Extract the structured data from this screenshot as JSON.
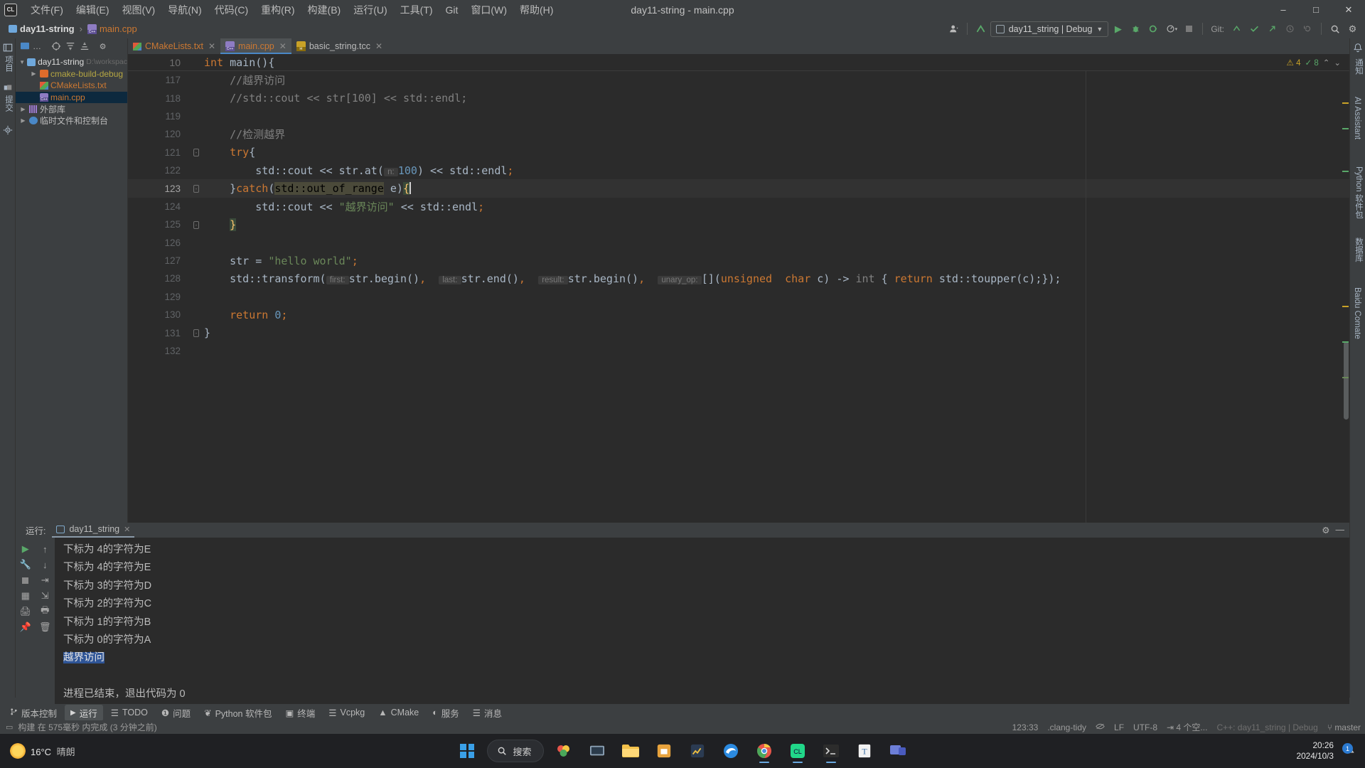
{
  "window": {
    "title": "day11-string - main.cpp"
  },
  "menu": {
    "items": [
      "文件(F)",
      "编辑(E)",
      "视图(V)",
      "导航(N)",
      "代码(C)",
      "重构(R)",
      "构建(B)",
      "运行(U)",
      "工具(T)",
      "Git",
      "窗口(W)",
      "帮助(H)"
    ],
    "logo": "CL"
  },
  "window_controls": {
    "minimize": "–",
    "maximize": "□",
    "close": "✕"
  },
  "navbar": {
    "project": "day11-string",
    "separator": "›",
    "file": "main.cpp",
    "run_config": "day11_string | Debug",
    "git_label": "Git:",
    "branch": "master"
  },
  "project_tool": {
    "title": "项目",
    "more": "…",
    "tree": [
      {
        "label": "day11-string",
        "path": "D:\\workspac",
        "expanded": true,
        "depth": 0,
        "icon": "module-icon"
      },
      {
        "label": "cmake-build-debug",
        "path": "",
        "expanded": false,
        "depth": 1,
        "icon": "folder-orange-icon"
      },
      {
        "label": "CMakeLists.txt",
        "path": "",
        "depth": 1,
        "icon": "cmake-icon"
      },
      {
        "label": "main.cpp",
        "path": "",
        "depth": 1,
        "icon": "cpp-icon",
        "selected": true
      },
      {
        "label": "外部库",
        "path": "",
        "expanded": false,
        "depth": 0,
        "icon": "library-icon"
      },
      {
        "label": "临时文件和控制台",
        "path": "",
        "expanded": false,
        "depth": 0,
        "icon": "scratch-icon"
      }
    ]
  },
  "left_strip": {
    "labels": [
      "项目",
      "提交",
      "结构"
    ]
  },
  "right_strip": {
    "labels": [
      "通知",
      "AI Assistant",
      "Python 软件包",
      "数据库",
      "Baidu Comate"
    ]
  },
  "tabs": [
    {
      "label": "CMakeLists.txt",
      "icon": "cmake-icon",
      "active": false
    },
    {
      "label": "main.cpp",
      "icon": "cpp-icon",
      "active": true
    },
    {
      "label": "basic_string.tcc",
      "icon": "header-icon",
      "active": false
    }
  ],
  "editor": {
    "sticky_line_number": "10",
    "sticky_text": "int main(){",
    "inspections": {
      "warnings": "4",
      "oks": "8"
    },
    "breadcrumb_function": "main",
    "lines": [
      {
        "n": "117",
        "tokens": [
          {
            "t": "    ",
            "c": "c-def"
          },
          {
            "t": "//越界访问",
            "c": "c-comment"
          }
        ]
      },
      {
        "n": "118",
        "tokens": [
          {
            "t": "    ",
            "c": "c-def"
          },
          {
            "t": "//std::cout << str[100] << std::endl;",
            "c": "c-comment"
          }
        ]
      },
      {
        "n": "119",
        "tokens": []
      },
      {
        "n": "120",
        "tokens": [
          {
            "t": "    ",
            "c": "c-def"
          },
          {
            "t": "//检测越界",
            "c": "c-comment"
          }
        ]
      },
      {
        "n": "121",
        "fold": "-",
        "tokens": [
          {
            "t": "    ",
            "c": "c-def"
          },
          {
            "t": "try",
            "c": "c-kw"
          },
          {
            "t": "{",
            "c": "c-punct"
          }
        ]
      },
      {
        "n": "122",
        "tokens": [
          {
            "t": "        ",
            "c": "c-def"
          },
          {
            "t": "std::cout",
            "c": "c-def"
          },
          {
            "t": " << ",
            "c": "c-punct"
          },
          {
            "t": "str.at(",
            "c": "c-def"
          },
          {
            "t": " n: ",
            "c": "c-hint"
          },
          {
            "t": "100",
            "c": "c-num"
          },
          {
            "t": ")",
            "c": "c-punct"
          },
          {
            "t": " << ",
            "c": "c-punct"
          },
          {
            "t": "std::endl",
            "c": "c-def"
          },
          {
            "t": ";",
            "c": "c-semi"
          }
        ]
      },
      {
        "n": "123",
        "current": true,
        "fold": "-",
        "tokens": [
          {
            "t": "    }",
            "c": "c-punct"
          },
          {
            "t": "catch",
            "c": "c-kw"
          },
          {
            "t": "(",
            "c": "c-punct"
          },
          {
            "t": "std::out_of_range",
            "c": "hl-ident"
          },
          {
            "t": " e)",
            "c": "c-punct"
          },
          {
            "t": "{",
            "c": "c-brace-hl"
          }
        ]
      },
      {
        "n": "124",
        "tokens": [
          {
            "t": "        ",
            "c": "c-def"
          },
          {
            "t": "std::cout",
            "c": "c-def"
          },
          {
            "t": " << ",
            "c": "c-punct"
          },
          {
            "t": "\"越界访问\"",
            "c": "c-str"
          },
          {
            "t": " << ",
            "c": "c-punct"
          },
          {
            "t": "std::endl",
            "c": "c-def"
          },
          {
            "t": ";",
            "c": "c-semi"
          }
        ]
      },
      {
        "n": "125",
        "fold": "-",
        "tokens": [
          {
            "t": "    ",
            "c": "c-def"
          },
          {
            "t": "}",
            "c": "c-brace-hl"
          }
        ]
      },
      {
        "n": "126",
        "tokens": []
      },
      {
        "n": "127",
        "tokens": [
          {
            "t": "    ",
            "c": "c-def"
          },
          {
            "t": "str",
            "c": "c-def"
          },
          {
            "t": " = ",
            "c": "c-punct"
          },
          {
            "t": "\"hello world\"",
            "c": "c-str"
          },
          {
            "t": ";",
            "c": "c-semi"
          }
        ]
      },
      {
        "n": "128",
        "tokens": [
          {
            "t": "    ",
            "c": "c-def"
          },
          {
            "t": "std::transform(",
            "c": "c-def"
          },
          {
            "t": " first: ",
            "c": "c-hint"
          },
          {
            "t": "str.begin()",
            "c": "c-def"
          },
          {
            "t": ",",
            "c": "c-semi"
          },
          {
            "t": "  ",
            "c": "c-def"
          },
          {
            "t": " last: ",
            "c": "c-hint"
          },
          {
            "t": "str.end()",
            "c": "c-def"
          },
          {
            "t": ",",
            "c": "c-semi"
          },
          {
            "t": "  ",
            "c": "c-def"
          },
          {
            "t": " result: ",
            "c": "c-hint"
          },
          {
            "t": "str.begin()",
            "c": "c-def"
          },
          {
            "t": ",",
            "c": "c-semi"
          },
          {
            "t": "  ",
            "c": "c-def"
          },
          {
            "t": " unary_op: ",
            "c": "c-hint"
          },
          {
            "t": "[](",
            "c": "c-punct"
          },
          {
            "t": "unsigned",
            "c": "c-kw"
          },
          {
            "t": "  ",
            "c": "c-def"
          },
          {
            "t": "char",
            "c": "c-kw"
          },
          {
            "t": " c) -> ",
            "c": "c-punct"
          },
          {
            "t": "int",
            "c": "c-comment"
          },
          {
            "t": " { ",
            "c": "c-punct"
          },
          {
            "t": "return",
            "c": "c-kw"
          },
          {
            "t": " std::toupper(c);});",
            "c": "c-def"
          }
        ]
      },
      {
        "n": "129",
        "tokens": []
      },
      {
        "n": "130",
        "tokens": [
          {
            "t": "    ",
            "c": "c-def"
          },
          {
            "t": "return",
            "c": "c-kw"
          },
          {
            "t": " ",
            "c": "c-def"
          },
          {
            "t": "0",
            "c": "c-num"
          },
          {
            "t": ";",
            "c": "c-semi"
          }
        ]
      },
      {
        "n": "131",
        "fold": "-",
        "tokens": [
          {
            "t": "}",
            "c": "c-punct"
          }
        ]
      },
      {
        "n": "132",
        "tokens": []
      }
    ]
  },
  "run_panel": {
    "label": "运行:",
    "tab": "day11_string",
    "close": "✕",
    "console_lines": [
      {
        "text": "下标为 4的字符为E",
        "highlight": false
      },
      {
        "text": "下标为 4的字符为E",
        "highlight": false
      },
      {
        "text": "下标为 3的字符为D",
        "highlight": false
      },
      {
        "text": "下标为 2的字符为C",
        "highlight": false
      },
      {
        "text": "下标为 1的字符为B",
        "highlight": false
      },
      {
        "text": "下标为 0的字符为A",
        "highlight": false
      },
      {
        "text": "越界访问",
        "highlight": true
      },
      {
        "text": "",
        "highlight": false
      },
      {
        "text": "进程已结束，退出代码为 0",
        "highlight": false
      }
    ]
  },
  "tool_windows": [
    {
      "label": "版本控制",
      "icon": "branch-icon",
      "active": false
    },
    {
      "label": "运行",
      "icon": "play-icon",
      "active": true
    },
    {
      "label": "TODO",
      "icon": "list-icon",
      "active": false
    },
    {
      "label": "问题",
      "icon": "warning-icon",
      "active": false
    },
    {
      "label": "Python 软件包",
      "icon": "packages-icon",
      "active": false
    },
    {
      "label": "终端",
      "icon": "terminal-icon",
      "active": false
    },
    {
      "label": "Vcpkg",
      "icon": "list-icon",
      "active": false
    },
    {
      "label": "CMake",
      "icon": "cmake-icon",
      "active": false
    },
    {
      "label": "服务",
      "icon": "services-icon",
      "active": false
    },
    {
      "label": "消息",
      "icon": "message-icon",
      "active": false
    }
  ],
  "status_bar": {
    "build_message": "构建 在 575毫秒 内完成 (3 分钟之前)",
    "caret_position": "123:33",
    "inspection": ".clang-tidy",
    "line_separator": "LF",
    "encoding": "UTF-8",
    "indent": "4 个空...",
    "config": "C++: day11_string | Debug",
    "branch": "master"
  },
  "taskbar": {
    "weather_temp": "16°C",
    "weather_desc": "晴朗",
    "search_placeholder": "搜索",
    "clock_time": "20:26",
    "clock_date": "2024/10/3",
    "notification_count": "1",
    "apps": [
      "windows-start",
      "search",
      "widgets",
      "file-explorer",
      "store",
      "chart-app",
      "edge",
      "chrome",
      "clion",
      "terminal",
      "text-app",
      "teams"
    ]
  }
}
